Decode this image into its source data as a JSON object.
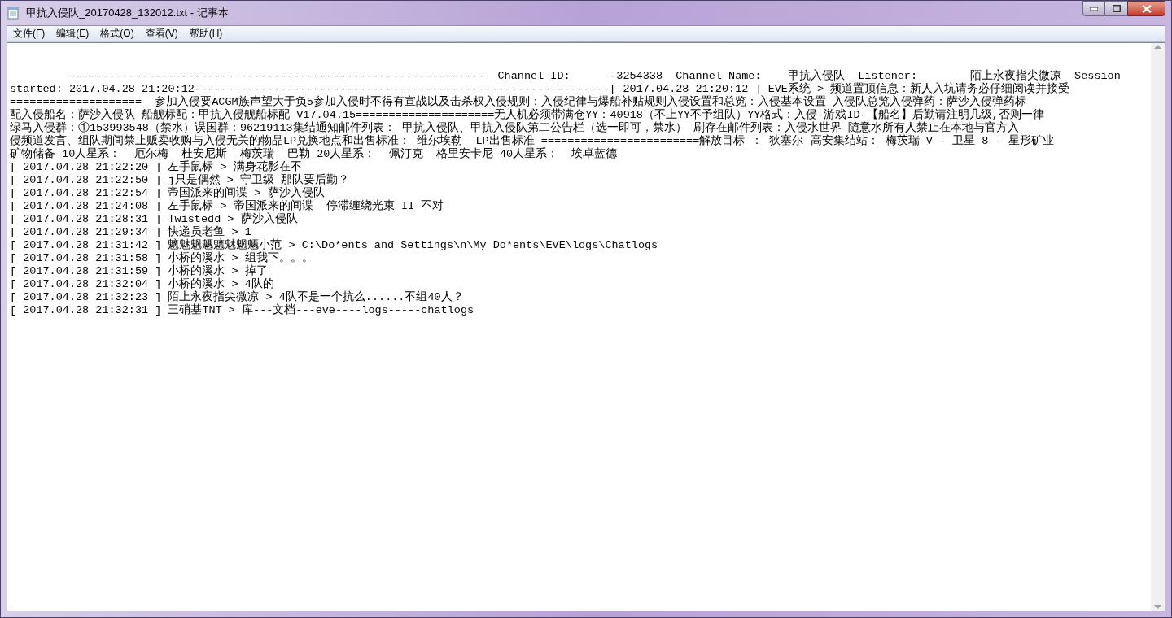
{
  "window": {
    "title": "甲抗入侵队_20170428_132012.txt - 记事本"
  },
  "menu": [
    "文件(F)",
    "编辑(E)",
    "格式(O)",
    "查看(V)",
    "帮助(H)"
  ],
  "document": {
    "lines": [
      "         ---------------------------------------------------------------  Channel ID:      -3254338  Channel Name:    甲抗入侵队  Listener:        陌上永夜指尖微凉  Session",
      "started: 2017.04.28 21:20:12---------------------------------------------------------------[ 2017.04.28 21:20:12 ] EVE系统 > 频道置顶信息：新人入坑请务必仔细阅读并接受",
      "====================  参加入侵要ACGM族声望大于负5参加入侵时不得有宣战以及击杀权入侵规则：入侵纪律与爆船补贴规则入侵设置和总览：入侵基本设置 入侵队总览入侵弹药：萨沙入侵弹药标",
      "配入侵船名：萨沙入侵队 船舰标配：甲抗入侵舰船标配 V17.04.15=====================无人机必须带满仓YY：40918（不上YY不予组队）YY格式：入侵-游戏ID-【船名】后勤请注明几级,否则一律",
      "绿马入侵群：①153993548（禁水）误国群：96219113集结通知邮件列表： 甲抗入侵队、甲抗入侵队第二公告栏（选一即可，禁水） 刷存在邮件列表：入侵水世界 随意水所有人禁止在本地与官方入",
      "侵频道发言、组队期间禁止贩卖收购与入侵无关的物品LP兑换地点和出售标准： 维尔埃勒  LP出售标准 ========================解放目标 ： 狄塞尔 高安集结站： 梅茨瑞 V - 卫星 8 - 星形矿业",
      "矿物储备 10人星系：  厄尔梅  杜安尼斯  梅茨瑞  巴勒 20人星系：  佩汀克  格里安卡尼 40人星系：  埃卓蓝德",
      "[ 2017.04.28 21:22:20 ] 左手鼠标 > 满身花影在不",
      "[ 2017.04.28 21:22:50 ] j只是偶然 > 守卫级 那队要后勤？",
      "[ 2017.04.28 21:22:54 ] 帝国派来的间谍 > 萨沙入侵队",
      "[ 2017.04.28 21:24:08 ] 左手鼠标 > 帝国派来的间谍  停滞缠绕光束 II 不对",
      "[ 2017.04.28 21:28:31 ] Twistedd > 萨沙入侵队",
      "[ 2017.04.28 21:29:34 ] 快递员老鱼 > 1",
      "[ 2017.04.28 21:31:42 ] 魑魅魍魉魑魅魍魉小范 > C:\\Do*ents and Settings\\n\\My Do*ents\\EVE\\logs\\Chatlogs",
      "[ 2017.04.28 21:31:58 ] 小桥的溪水 > 组我下。。。",
      "[ 2017.04.28 21:31:59 ] 小桥的溪水 > 掉了",
      "[ 2017.04.28 21:32:04 ] 小桥的溪水 > 4队的",
      "[ 2017.04.28 21:32:23 ] 陌上永夜指尖微凉 > 4队不是一个抗么......不组40人？",
      "[ 2017.04.28 21:32:31 ] 三硝基TNT > 库---文档---eve----logs-----chatlogs"
    ]
  }
}
